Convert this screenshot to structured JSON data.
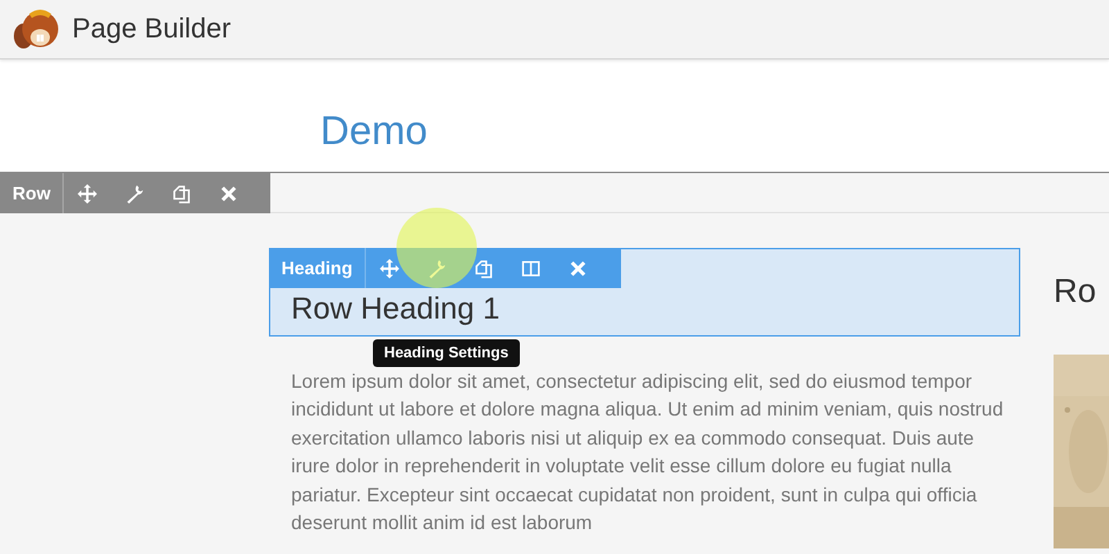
{
  "app": {
    "title": "Page Builder"
  },
  "page": {
    "title": "Demo"
  },
  "row_toolbar": {
    "label": "Row",
    "tools": [
      {
        "kind": "move"
      },
      {
        "kind": "settings"
      },
      {
        "kind": "duplicate"
      },
      {
        "kind": "close"
      }
    ]
  },
  "module_toolbar": {
    "label": "Heading",
    "tools": [
      {
        "kind": "move"
      },
      {
        "kind": "settings"
      },
      {
        "kind": "duplicate"
      },
      {
        "kind": "columns"
      },
      {
        "kind": "close"
      }
    ]
  },
  "tooltip": "Heading Settings",
  "heading": "Row Heading 1",
  "paragraph": "Lorem ipsum dolor sit amet, consectetur adipiscing elit, sed do eiusmod tempor incididunt ut labore et dolore magna aliqua. Ut enim ad minim veniam, quis nostrud exercitation ullamco laboris nisi ut aliquip ex ea commodo consequat. Duis aute irure dolor in reprehenderit in voluptate velit esse cillum dolore eu fugiat nulla pariatur. Excepteur sint occaecat cupidatat non proident, sunt in culpa qui officia deserunt mollit anim id est laborum",
  "side_heading": "Ro"
}
